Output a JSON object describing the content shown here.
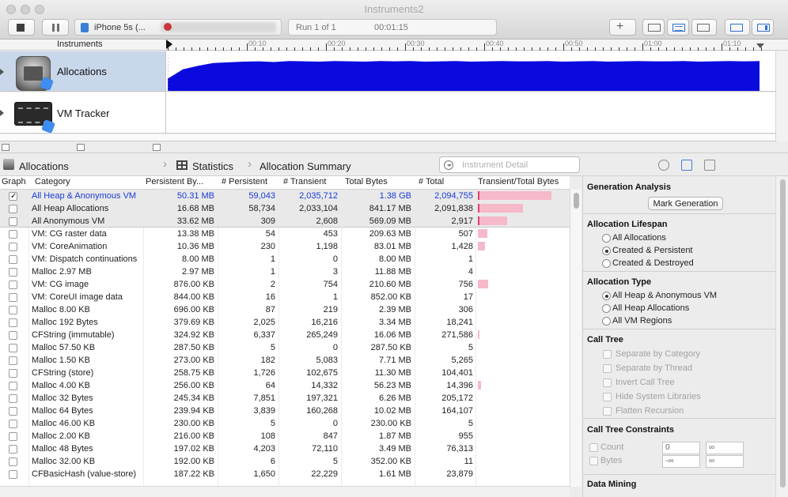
{
  "window": {
    "title": "Instruments2"
  },
  "toolbar": {
    "device": "iPhone 5s (...",
    "run": "Run 1 of 1",
    "time": "00:01:15"
  },
  "timeline": {
    "header_label": "Instruments",
    "ruler_labels": [
      "00:10",
      "00:20",
      "00:30",
      "00:40",
      "00:50",
      "01:00",
      "01:10"
    ],
    "tracks": [
      {
        "name": "Allocations"
      },
      {
        "name": "VM Tracker"
      }
    ],
    "allocation_graph": {
      "color": "#0a0adf",
      "relative_heights": [
        0.35,
        0.62,
        0.72,
        0.8,
        0.82,
        0.84,
        0.85,
        0.83,
        0.86,
        0.85,
        0.84,
        0.86,
        0.85,
        0.84,
        0.86,
        0.85,
        0.86,
        0.84,
        0.85,
        0.86,
        0.84,
        0.85,
        0.86,
        0.85,
        0.85,
        0.86,
        0.84,
        0.85,
        0.86,
        0.84,
        0.85,
        0.86,
        0.85,
        0.85,
        0.86,
        0.84,
        0.85,
        0.86,
        0.85,
        0.86
      ]
    }
  },
  "jumpbar": {
    "instrument": "Allocations",
    "view": "Statistics",
    "detail": "Allocation Summary",
    "search_placeholder": "Instrument Detail"
  },
  "table": {
    "headers": [
      "Graph",
      "Category",
      "Persistent By...",
      "# Persistent",
      "# Transient",
      "Total Bytes",
      "# Total",
      "Transient/Total Bytes"
    ],
    "rows": [
      {
        "checked": true,
        "category": "All Heap & Anonymous VM",
        "persistent_bytes": "50.31 MB",
        "persistent": "59,043",
        "transient": "2,035,712",
        "total_bytes": "1.38 GB",
        "total": "2,094,755",
        "ratio": 0.97,
        "mark": true
      },
      {
        "checked": false,
        "category": "All Heap Allocations",
        "persistent_bytes": "16.68 MB",
        "persistent": "58,734",
        "transient": "2,033,104",
        "total_bytes": "841.17 MB",
        "total": "2,091,838",
        "ratio": 0.59,
        "mark": true
      },
      {
        "checked": false,
        "category": "All Anonymous VM",
        "persistent_bytes": "33.62 MB",
        "persistent": "309",
        "transient": "2,608",
        "total_bytes": "569.09 MB",
        "total": "2,917",
        "ratio": 0.39,
        "mark": true
      },
      {
        "checked": false,
        "category": "VM: CG raster data",
        "persistent_bytes": "13.38 MB",
        "persistent": "54",
        "transient": "453",
        "total_bytes": "209.63 MB",
        "total": "507",
        "ratio": 0.13,
        "mark": false
      },
      {
        "checked": false,
        "category": "VM: CoreAnimation",
        "persistent_bytes": "10.36 MB",
        "persistent": "230",
        "transient": "1,198",
        "total_bytes": "83.01 MB",
        "total": "1,428",
        "ratio": 0.09,
        "mark": false
      },
      {
        "checked": false,
        "category": "VM: Dispatch continuations",
        "persistent_bytes": "8.00 MB",
        "persistent": "1",
        "transient": "0",
        "total_bytes": "8.00 MB",
        "total": "1",
        "ratio": 0,
        "mark": false
      },
      {
        "checked": false,
        "category": "Malloc 2.97 MB",
        "persistent_bytes": "2.97 MB",
        "persistent": "1",
        "transient": "3",
        "total_bytes": "11.88 MB",
        "total": "4",
        "ratio": 0,
        "mark": false
      },
      {
        "checked": false,
        "category": "VM: CG image",
        "persistent_bytes": "876.00 KB",
        "persistent": "2",
        "transient": "754",
        "total_bytes": "210.60 MB",
        "total": "756",
        "ratio": 0.14,
        "mark": false
      },
      {
        "checked": false,
        "category": "VM: CoreUI image data",
        "persistent_bytes": "844.00 KB",
        "persistent": "16",
        "transient": "1",
        "total_bytes": "852.00 KB",
        "total": "17",
        "ratio": 0,
        "mark": false
      },
      {
        "checked": false,
        "category": "Malloc 8.00 KB",
        "persistent_bytes": "696.00 KB",
        "persistent": "87",
        "transient": "219",
        "total_bytes": "2.39 MB",
        "total": "306",
        "ratio": 0,
        "mark": false
      },
      {
        "checked": false,
        "category": "Malloc 192 Bytes",
        "persistent_bytes": "379.69 KB",
        "persistent": "2,025",
        "transient": "16,216",
        "total_bytes": "3.34 MB",
        "total": "18,241",
        "ratio": 0,
        "mark": false
      },
      {
        "checked": false,
        "category": "CFString (immutable)",
        "persistent_bytes": "324.92 KB",
        "persistent": "6,337",
        "transient": "265,249",
        "total_bytes": "16.06 MB",
        "total": "271,586",
        "ratio": 0.01,
        "mark": false
      },
      {
        "checked": false,
        "category": "Malloc 57.50 KB",
        "persistent_bytes": "287.50 KB",
        "persistent": "5",
        "transient": "0",
        "total_bytes": "287.50 KB",
        "total": "5",
        "ratio": 0,
        "mark": false
      },
      {
        "checked": false,
        "category": "Malloc 1.50 KB",
        "persistent_bytes": "273.00 KB",
        "persistent": "182",
        "transient": "5,083",
        "total_bytes": "7.71 MB",
        "total": "5,265",
        "ratio": 0,
        "mark": false
      },
      {
        "checked": false,
        "category": "CFString (store)",
        "persistent_bytes": "258.75 KB",
        "persistent": "1,726",
        "transient": "102,675",
        "total_bytes": "11.30 MB",
        "total": "104,401",
        "ratio": 0,
        "mark": false
      },
      {
        "checked": false,
        "category": "Malloc 4.00 KB",
        "persistent_bytes": "256.00 KB",
        "persistent": "64",
        "transient": "14,332",
        "total_bytes": "56.23 MB",
        "total": "14,396",
        "ratio": 0.04,
        "mark": false
      },
      {
        "checked": false,
        "category": "Malloc 32 Bytes",
        "persistent_bytes": "245.34 KB",
        "persistent": "7,851",
        "transient": "197,321",
        "total_bytes": "6.26 MB",
        "total": "205,172",
        "ratio": 0,
        "mark": false
      },
      {
        "checked": false,
        "category": "Malloc 64 Bytes",
        "persistent_bytes": "239.94 KB",
        "persistent": "3,839",
        "transient": "160,268",
        "total_bytes": "10.02 MB",
        "total": "164,107",
        "ratio": 0,
        "mark": false
      },
      {
        "checked": false,
        "category": "Malloc 46.00 KB",
        "persistent_bytes": "230.00 KB",
        "persistent": "5",
        "transient": "0",
        "total_bytes": "230.00 KB",
        "total": "5",
        "ratio": 0,
        "mark": false
      },
      {
        "checked": false,
        "category": "Malloc 2.00 KB",
        "persistent_bytes": "216.00 KB",
        "persistent": "108",
        "transient": "847",
        "total_bytes": "1.87 MB",
        "total": "955",
        "ratio": 0,
        "mark": false
      },
      {
        "checked": false,
        "category": "Malloc 48 Bytes",
        "persistent_bytes": "197.02 KB",
        "persistent": "4,203",
        "transient": "72,110",
        "total_bytes": "3.49 MB",
        "total": "76,313",
        "ratio": 0,
        "mark": false
      },
      {
        "checked": false,
        "category": "Malloc 32.00 KB",
        "persistent_bytes": "192.00 KB",
        "persistent": "6",
        "transient": "5",
        "total_bytes": "352.00 KB",
        "total": "11",
        "ratio": 0,
        "mark": false
      },
      {
        "checked": false,
        "category": "CFBasicHash (value-store)",
        "persistent_bytes": "187.22 KB",
        "persistent": "1,650",
        "transient": "22,229",
        "total_bytes": "1.61 MB",
        "total": "23,879",
        "ratio": 0,
        "mark": false
      }
    ],
    "bar_color": "#f6b9ca",
    "selected_color": "#1a3bd6"
  },
  "inspector": {
    "generation": {
      "title": "Generation Analysis",
      "button": "Mark Generation"
    },
    "lifespan": {
      "title": "Allocation Lifespan",
      "options": [
        "All Allocations",
        "Created & Persistent",
        "Created & Destroyed"
      ],
      "selected": 1
    },
    "type": {
      "title": "Allocation Type",
      "options": [
        "All Heap & Anonymous VM",
        "All Heap Allocations",
        "All VM Regions"
      ],
      "selected": 0
    },
    "calltree": {
      "title": "Call Tree",
      "options": [
        "Separate by Category",
        "Separate by Thread",
        "Invert Call Tree",
        "Hide System Libraries",
        "Flatten Recursion"
      ]
    },
    "constraints": {
      "title": "Call Tree Constraints",
      "count_label": "Count",
      "bytes_label": "Bytes",
      "count_min": "0",
      "count_max": "∞",
      "bytes_min": "-∞",
      "bytes_max": "∞"
    },
    "datamining": {
      "title": "Data Mining"
    }
  }
}
